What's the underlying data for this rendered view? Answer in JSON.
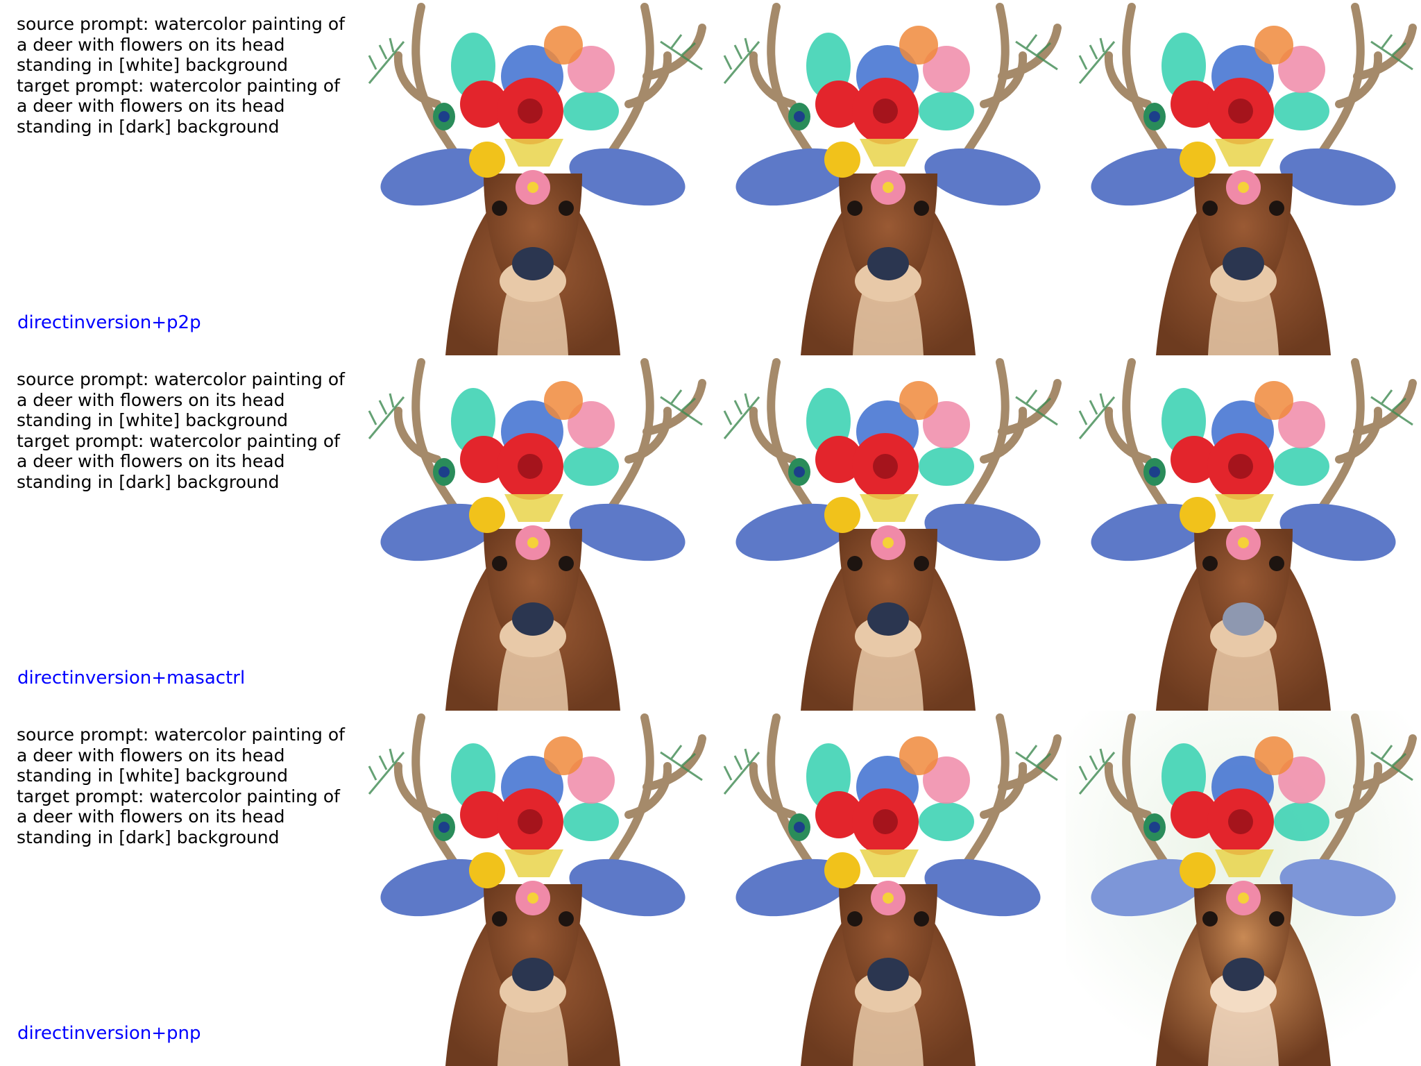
{
  "rows": [
    {
      "prompt_lines": [
        "source prompt: watercolor painting of",
        "a deer with flowers on its head",
        "standing in [white] background",
        "target prompt: watercolor painting of",
        "a deer with flowers on its head",
        "standing in [dark] background"
      ],
      "method": "directinversion+p2p",
      "panels": [
        {
          "variant": "source"
        },
        {
          "variant": "edit-faithful"
        },
        {
          "variant": "edit-faithful"
        }
      ]
    },
    {
      "prompt_lines": [
        "source prompt: watercolor painting of",
        "a deer with flowers on its head",
        "standing in [white] background",
        "target prompt: watercolor painting of",
        "a deer with flowers on its head",
        "standing in [dark] background"
      ],
      "method": "directinversion+masactrl",
      "panels": [
        {
          "variant": "source"
        },
        {
          "variant": "edit-faithful"
        },
        {
          "variant": "edit-pale-nose"
        }
      ]
    },
    {
      "prompt_lines": [
        "source prompt: watercolor painting of",
        "a deer with flowers on its head",
        "standing in [white] background",
        "target prompt: watercolor painting of",
        "a deer with flowers on its head",
        "standing in [dark] background"
      ],
      "method": "directinversion+pnp",
      "panels": [
        {
          "variant": "source"
        },
        {
          "variant": "edit-faithful"
        },
        {
          "variant": "edit-soft-watercolor"
        }
      ]
    }
  ],
  "colors": {
    "method_label": "#0000ff",
    "prompt_text": "#000000",
    "fur": "#9a5a34",
    "fur_light": "#e8c9a8",
    "antler": "#a58a6a",
    "ear_blue": "#5d79c8",
    "poppy": "#e3252c",
    "teal_petal": "#3fd3b4",
    "yellow_flower": "#f1c21b",
    "pink_flower": "#f08aa8",
    "nose": "#2b3650"
  }
}
